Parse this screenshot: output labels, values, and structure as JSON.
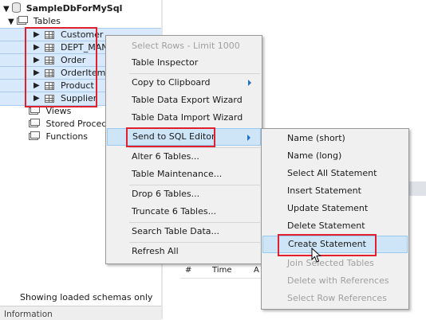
{
  "navigator": {
    "schema_name": "SampleDbForMySql",
    "tables_label": "Tables",
    "tables": [
      "Customer",
      "DEPT_MAN",
      "Order",
      "OrderItem",
      "Product",
      "Supplier"
    ],
    "views_label": "Views",
    "procedures_label": "Stored Proced",
    "functions_label": "Functions",
    "status_text": "Showing loaded schemas only",
    "info_label": "Information"
  },
  "result_grid": {
    "col_hash": "#",
    "col_time": "Time",
    "col_action": "A"
  },
  "context_menu": {
    "select_rows": "Select Rows - Limit 1000",
    "table_inspector": "Table Inspector",
    "copy_to_clipboard": "Copy to Clipboard",
    "table_data_export": "Table Data Export Wizard",
    "table_data_import": "Table Data Import Wizard",
    "send_to_sql_editor": "Send to SQL Editor",
    "alter_tables": "Alter 6 Tables...",
    "table_maintenance": "Table Maintenance...",
    "drop_tables": "Drop 6 Tables...",
    "truncate_tables": "Truncate 6 Tables...",
    "search_table_data": "Search Table Data...",
    "refresh_all": "Refresh All"
  },
  "submenu": {
    "name_short": "Name (short)",
    "name_long": "Name (long)",
    "select_all": "Select All Statement",
    "insert": "Insert Statement",
    "update": "Update Statement",
    "delete": "Delete Statement",
    "create": "Create Statement",
    "join_selected": "Join Selected Tables",
    "delete_with_refs": "Delete with References",
    "select_row_refs": "Select Row References"
  },
  "colors": {
    "selection": "#d7e9fb",
    "highlight_box": "#e0202c",
    "menu_bg": "#f0f0f0",
    "menu_hover": "#cde5f7",
    "submenu_arrow": "#1f6fd0"
  }
}
